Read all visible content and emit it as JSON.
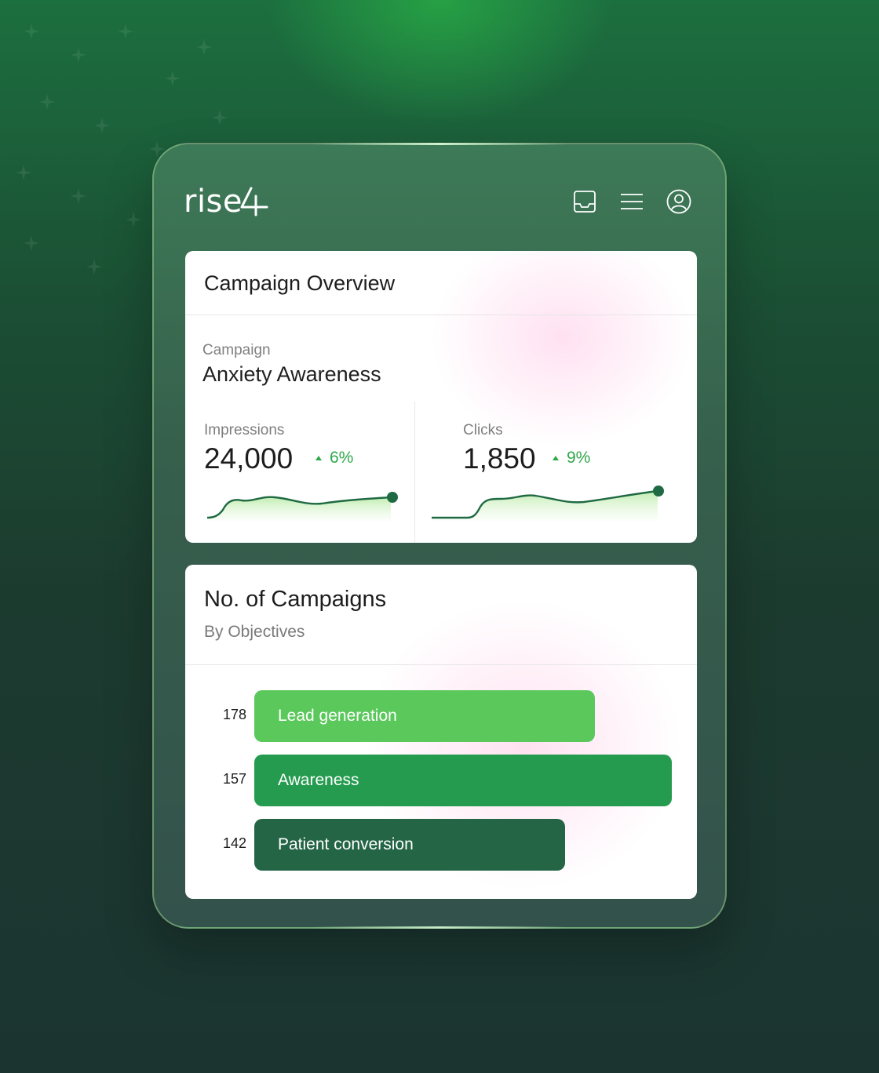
{
  "brand": {
    "logo_text": "rise4"
  },
  "colors": {
    "accent_green": "#2fa84a",
    "bar_light": "#5ac85a",
    "bar_mid": "#259b4f",
    "bar_dark": "#246545"
  },
  "header": {
    "icons": [
      "inbox-icon",
      "menu-icon",
      "user-icon"
    ]
  },
  "overview": {
    "title": "Campaign Overview",
    "campaign_label": "Campaign",
    "campaign_name": "Anxiety Awareness",
    "metrics": [
      {
        "label": "Impressions",
        "value": "24,000",
        "delta": "6%"
      },
      {
        "label": "Clicks",
        "value": "1,850",
        "delta": "9%"
      }
    ]
  },
  "campaigns": {
    "title": "No. of Campaigns",
    "subtitle": "By Objectives",
    "bars": [
      {
        "count": "178",
        "label": "Lead generation",
        "color": "#5ac85a"
      },
      {
        "count": "157",
        "label": "Awareness",
        "color": "#259b4f"
      },
      {
        "count": "142",
        "label": "Patient conversion",
        "color": "#246545"
      }
    ]
  }
}
